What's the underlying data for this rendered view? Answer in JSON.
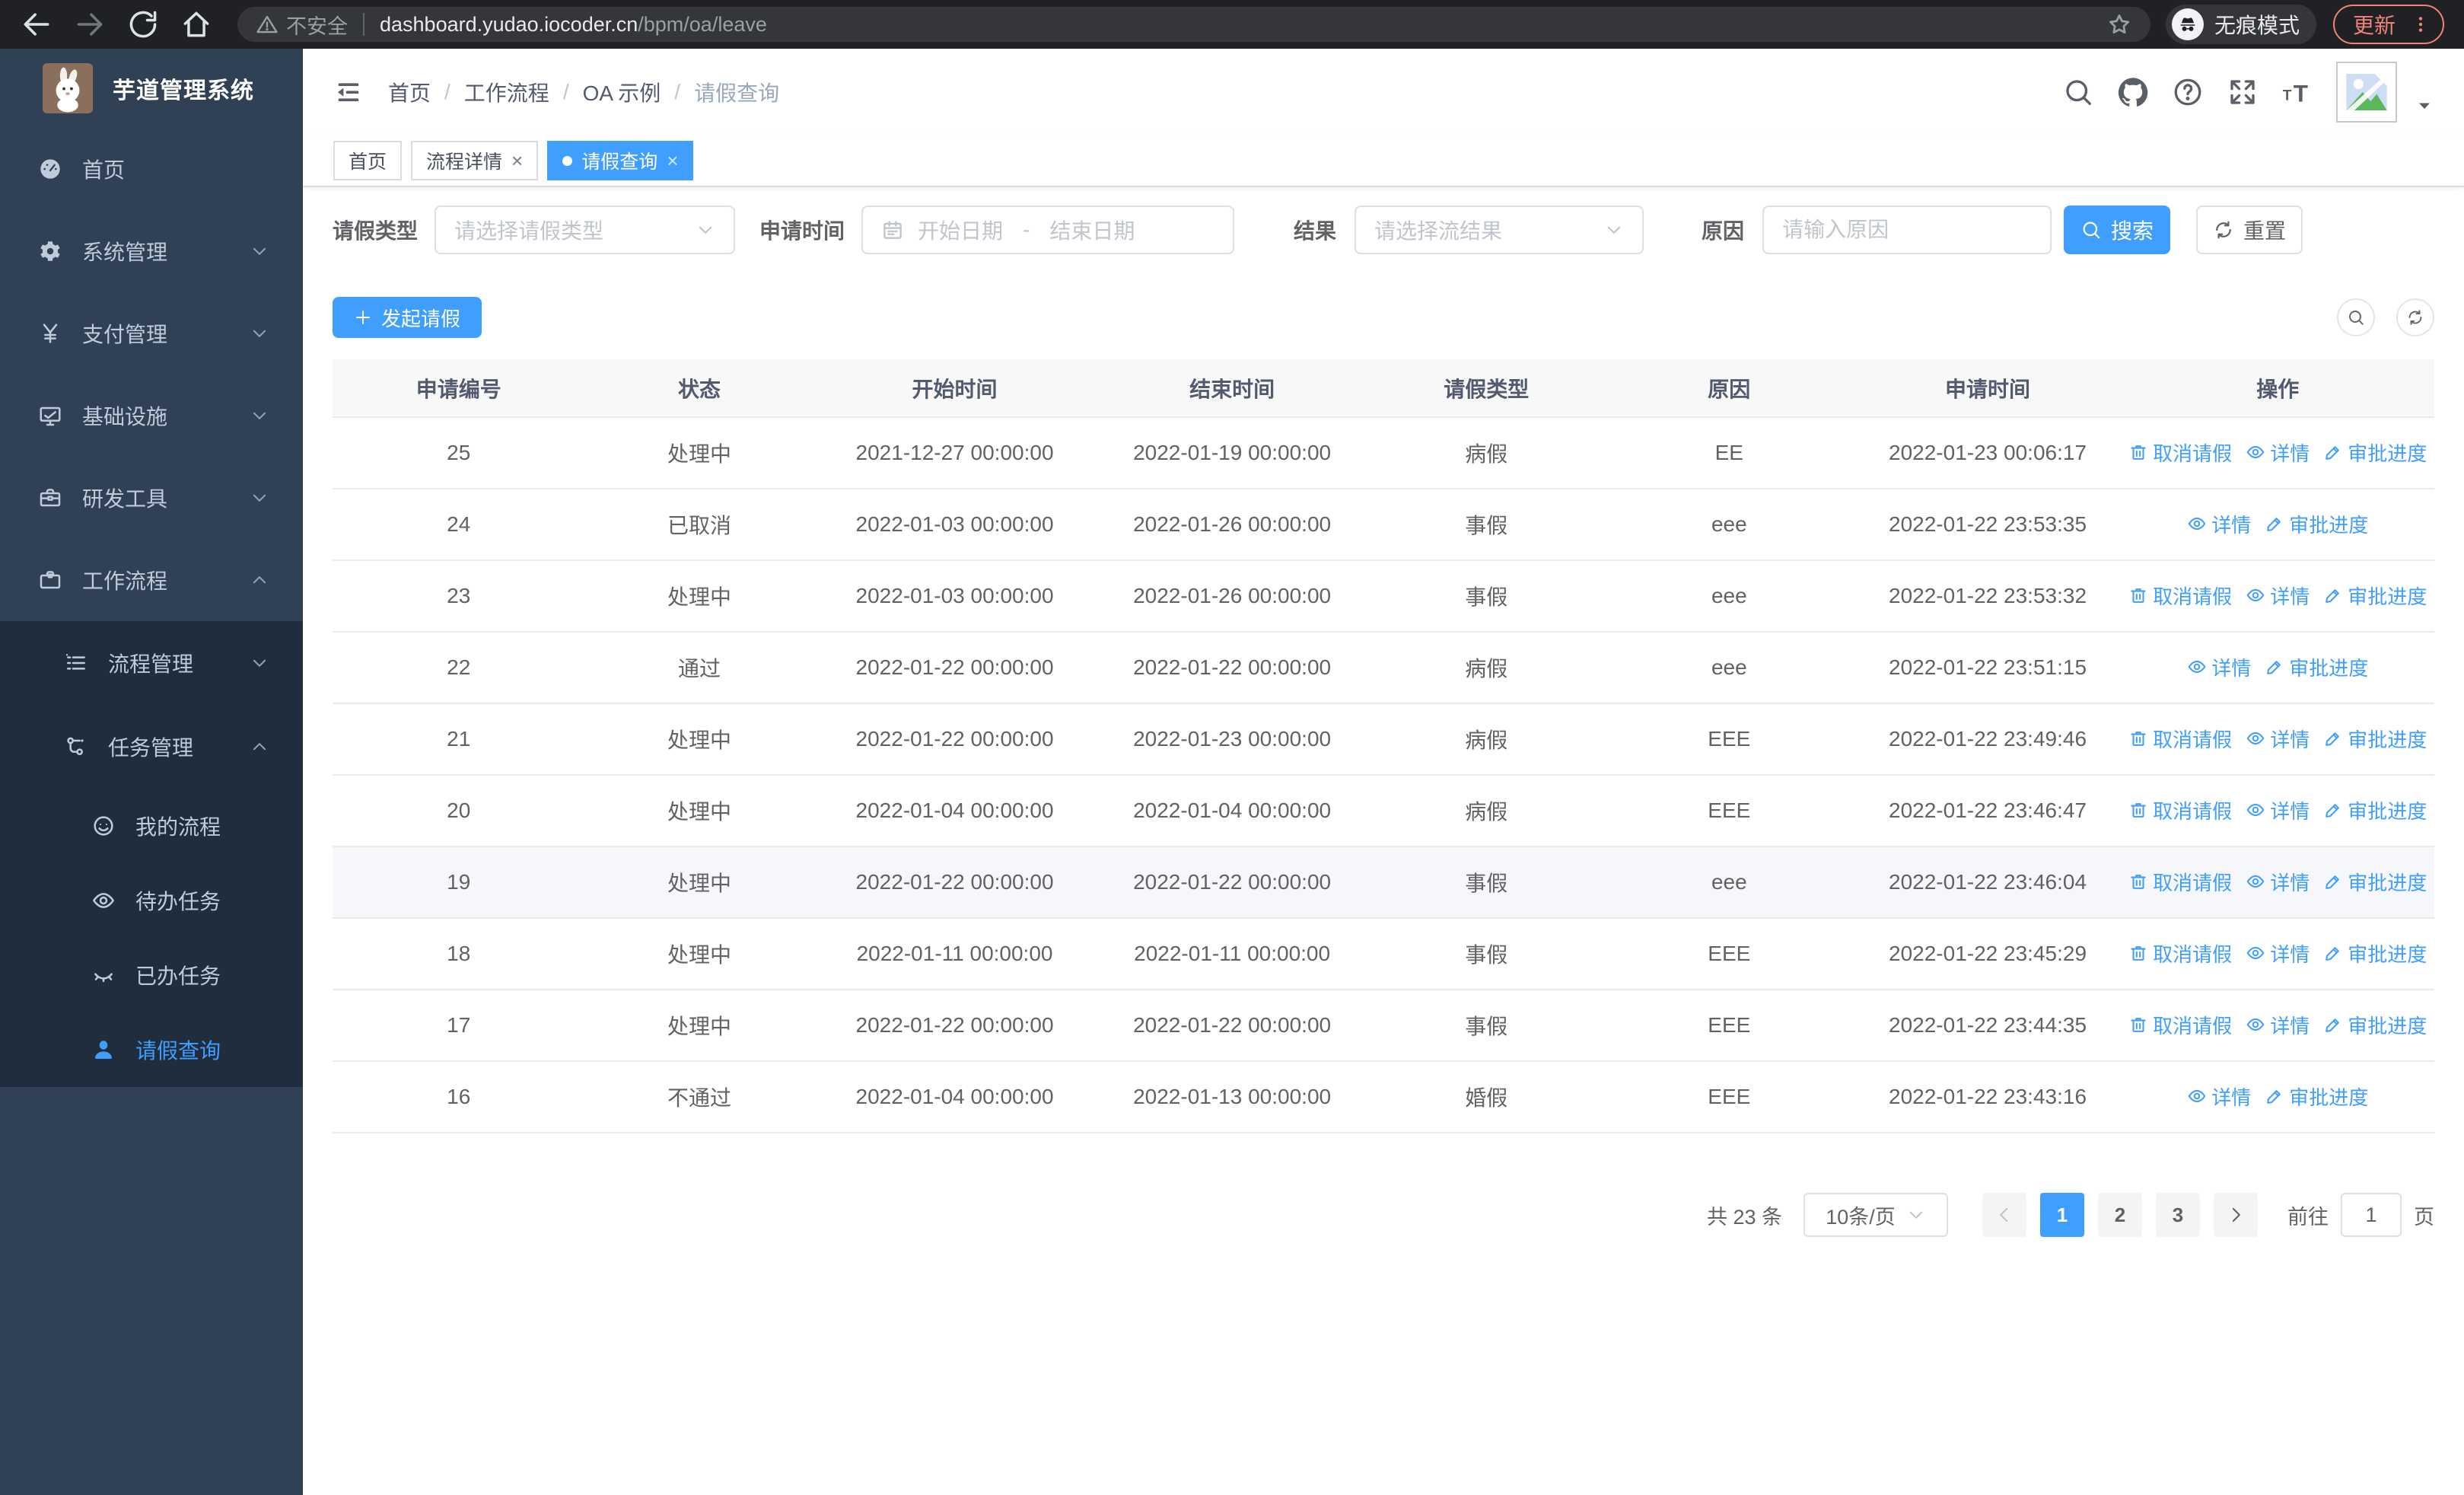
{
  "browser": {
    "security_label": "不安全",
    "url_host": "dashboard.yudao.iocoder.cn",
    "url_path": "/bpm/oa/leave",
    "incognito_label": "无痕模式",
    "update_label": "更新"
  },
  "sidebar": {
    "app_title": "芋道管理系统",
    "menu": [
      {
        "label": "首页",
        "icon": "dashboard-icon",
        "depth": 0,
        "arrow": null,
        "dark": false,
        "active": false
      },
      {
        "label": "系统管理",
        "icon": "gear-icon",
        "depth": 0,
        "arrow": "down",
        "dark": false,
        "active": false
      },
      {
        "label": "支付管理",
        "icon": "yen-icon",
        "depth": 0,
        "arrow": "down",
        "dark": false,
        "active": false
      },
      {
        "label": "基础设施",
        "icon": "monitor-icon",
        "depth": 0,
        "arrow": "down",
        "dark": false,
        "active": false
      },
      {
        "label": "研发工具",
        "icon": "toolbox-icon",
        "depth": 0,
        "arrow": "down",
        "dark": false,
        "active": false
      },
      {
        "label": "工作流程",
        "icon": "briefcase-icon",
        "depth": 0,
        "arrow": "up",
        "dark": false,
        "active": false
      },
      {
        "label": "流程管理",
        "icon": "process-icon",
        "depth": 1,
        "arrow": "down",
        "dark": true,
        "active": false
      },
      {
        "label": "任务管理",
        "icon": "flow-icon",
        "depth": 1,
        "arrow": "up",
        "dark": true,
        "active": false
      },
      {
        "label": "我的流程",
        "icon": "robot-icon",
        "depth": 2,
        "arrow": null,
        "dark": true,
        "active": false
      },
      {
        "label": "待办任务",
        "icon": "eye-open-icon",
        "depth": 2,
        "arrow": null,
        "dark": true,
        "active": false
      },
      {
        "label": "已办任务",
        "icon": "eye-closed-icon",
        "depth": 2,
        "arrow": null,
        "dark": true,
        "active": false
      },
      {
        "label": "请假查询",
        "icon": "user-icon",
        "depth": 2,
        "arrow": null,
        "dark": true,
        "active": true
      }
    ]
  },
  "header": {
    "breadcrumbs": [
      "首页",
      "工作流程",
      "OA 示例",
      "请假查询"
    ],
    "icons": [
      "search-icon",
      "github-icon",
      "help-icon",
      "fullscreen-icon",
      "font-size-icon"
    ]
  },
  "tabs": [
    {
      "label": "首页",
      "closable": false,
      "active": false
    },
    {
      "label": "流程详情",
      "closable": true,
      "active": false
    },
    {
      "label": "请假查询",
      "closable": true,
      "active": true
    }
  ],
  "filters": {
    "leave_type": {
      "label": "请假类型",
      "placeholder": "请选择请假类型"
    },
    "apply_time": {
      "label": "申请时间",
      "start_placeholder": "开始日期",
      "separator": "-",
      "end_placeholder": "结束日期"
    },
    "result": {
      "label": "结果",
      "placeholder": "请选择流结果"
    },
    "reason": {
      "label": "原因",
      "placeholder": "请输入原因"
    },
    "search_label": "搜索",
    "reset_label": "重置"
  },
  "toolbar": {
    "create_label": "发起请假"
  },
  "actions": {
    "cancel": {
      "label": "取消请假",
      "icon": "trash-icon"
    },
    "detail": {
      "label": "详情",
      "icon": "eye-open-icon"
    },
    "audit": {
      "label": "审批进度",
      "icon": "pen-icon"
    }
  },
  "table": {
    "columns": [
      "申请编号",
      "状态",
      "开始时间",
      "结束时间",
      "请假类型",
      "原因",
      "申请时间",
      "操作"
    ],
    "rows": [
      {
        "id": "25",
        "status": "处理中",
        "start": "2021-12-27 00:00:00",
        "end": "2022-01-19 00:00:00",
        "type": "病假",
        "reason": "EE",
        "applied": "2022-01-23 00:06:17",
        "actions": [
          "cancel",
          "detail",
          "audit"
        ],
        "highlighted": false
      },
      {
        "id": "24",
        "status": "已取消",
        "start": "2022-01-03 00:00:00",
        "end": "2022-01-26 00:00:00",
        "type": "事假",
        "reason": "eee",
        "applied": "2022-01-22 23:53:35",
        "actions": [
          "detail",
          "audit"
        ],
        "highlighted": false
      },
      {
        "id": "23",
        "status": "处理中",
        "start": "2022-01-03 00:00:00",
        "end": "2022-01-26 00:00:00",
        "type": "事假",
        "reason": "eee",
        "applied": "2022-01-22 23:53:32",
        "actions": [
          "cancel",
          "detail",
          "audit"
        ],
        "highlighted": false
      },
      {
        "id": "22",
        "status": "通过",
        "start": "2022-01-22 00:00:00",
        "end": "2022-01-22 00:00:00",
        "type": "病假",
        "reason": "eee",
        "applied": "2022-01-22 23:51:15",
        "actions": [
          "detail",
          "audit"
        ],
        "highlighted": false
      },
      {
        "id": "21",
        "status": "处理中",
        "start": "2022-01-22 00:00:00",
        "end": "2022-01-23 00:00:00",
        "type": "病假",
        "reason": "EEE",
        "applied": "2022-01-22 23:49:46",
        "actions": [
          "cancel",
          "detail",
          "audit"
        ],
        "highlighted": false
      },
      {
        "id": "20",
        "status": "处理中",
        "start": "2022-01-04 00:00:00",
        "end": "2022-01-04 00:00:00",
        "type": "病假",
        "reason": "EEE",
        "applied": "2022-01-22 23:46:47",
        "actions": [
          "cancel",
          "detail",
          "audit"
        ],
        "highlighted": false
      },
      {
        "id": "19",
        "status": "处理中",
        "start": "2022-01-22 00:00:00",
        "end": "2022-01-22 00:00:00",
        "type": "事假",
        "reason": "eee",
        "applied": "2022-01-22 23:46:04",
        "actions": [
          "cancel",
          "detail",
          "audit"
        ],
        "highlighted": true
      },
      {
        "id": "18",
        "status": "处理中",
        "start": "2022-01-11 00:00:00",
        "end": "2022-01-11 00:00:00",
        "type": "事假",
        "reason": "EEE",
        "applied": "2022-01-22 23:45:29",
        "actions": [
          "cancel",
          "detail",
          "audit"
        ],
        "highlighted": false
      },
      {
        "id": "17",
        "status": "处理中",
        "start": "2022-01-22 00:00:00",
        "end": "2022-01-22 00:00:00",
        "type": "事假",
        "reason": "EEE",
        "applied": "2022-01-22 23:44:35",
        "actions": [
          "cancel",
          "detail",
          "audit"
        ],
        "highlighted": false
      },
      {
        "id": "16",
        "status": "不通过",
        "start": "2022-01-04 00:00:00",
        "end": "2022-01-13 00:00:00",
        "type": "婚假",
        "reason": "EEE",
        "applied": "2022-01-22 23:43:16",
        "actions": [
          "detail",
          "audit"
        ],
        "highlighted": false
      }
    ]
  },
  "pagination": {
    "total_label": "共 23 条",
    "page_size": "10条/页",
    "pages": [
      "1",
      "2",
      "3"
    ],
    "active_page": "1",
    "jump_prefix": "前往",
    "jump_value": "1",
    "jump_suffix": "页"
  },
  "colors": {
    "primary": "#409eff",
    "sidebar_bg": "#304156",
    "submenu_bg": "#1f2d3d",
    "chrome_bg": "#202124",
    "update_accent": "#ee8378"
  }
}
